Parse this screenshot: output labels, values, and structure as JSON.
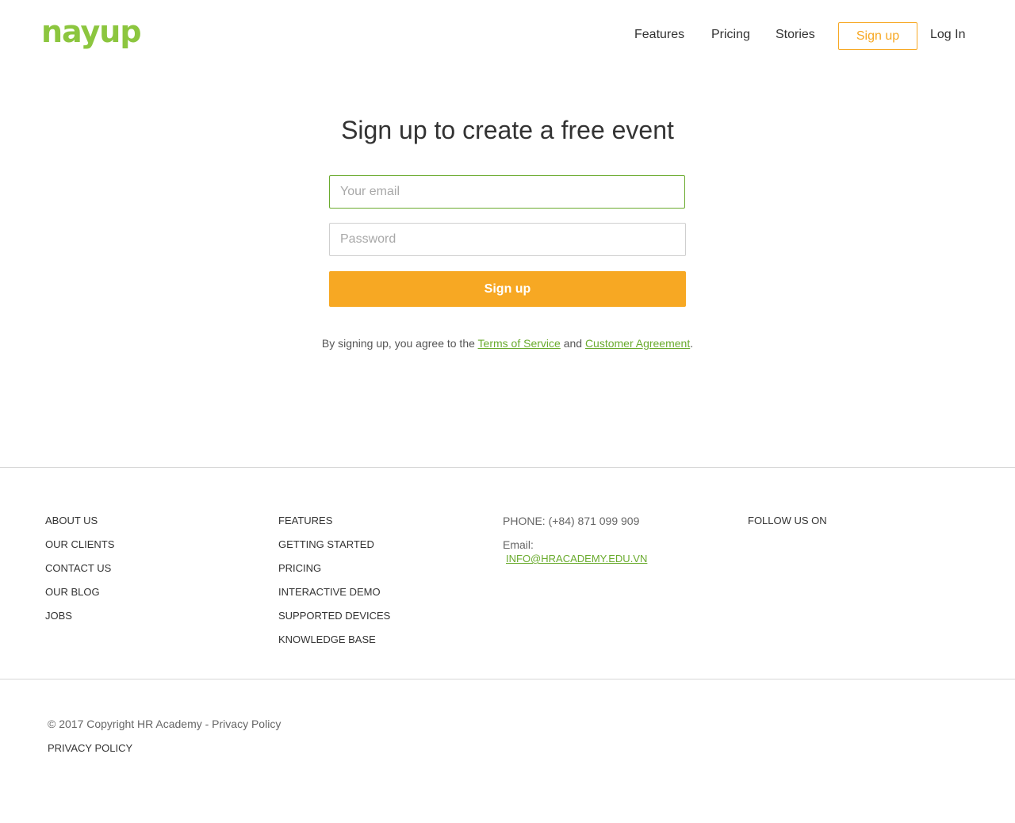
{
  "header": {
    "logo_text": "nayup",
    "nav": {
      "features": "Features",
      "pricing": "Pricing",
      "stories": "Stories",
      "signup": "Sign up",
      "login": "Log In"
    }
  },
  "main": {
    "headline": "Sign up to create a free event",
    "email_placeholder": "Your email",
    "password_placeholder": "Password",
    "signup_button": "Sign up",
    "agree_prefix": "By signing up, you agree to the",
    "terms_link": "Terms of Service",
    "agree_and": "and",
    "agreement_link": "Customer Agreement",
    "agree_suffix": "."
  },
  "footer": {
    "col1": [
      "ABOUT US",
      "OUR CLIENTS",
      "CONTACT US",
      "OUR BLOG",
      "JOBS"
    ],
    "col2": [
      "FEATURES",
      "GETTING STARTED",
      "PRICING",
      "INTERACTIVE DEMO",
      "SUPPORTED DEVICES",
      "KNOWLEDGE BASE"
    ],
    "phone": "PHONE: (+84) 871 099 909",
    "email_label": "Email:",
    "email_value": "info@hracademy.edu.vn",
    "follow_label": "FOLLOW US ON",
    "copyright": "© 2017 Copyright HR Academy - Privacy Policy",
    "privacy_policy": "PRIVACY POLICY"
  },
  "colors": {
    "brand_green": "#8cc63f",
    "link_green": "#6aab2e",
    "accent_orange": "#f7a823"
  }
}
